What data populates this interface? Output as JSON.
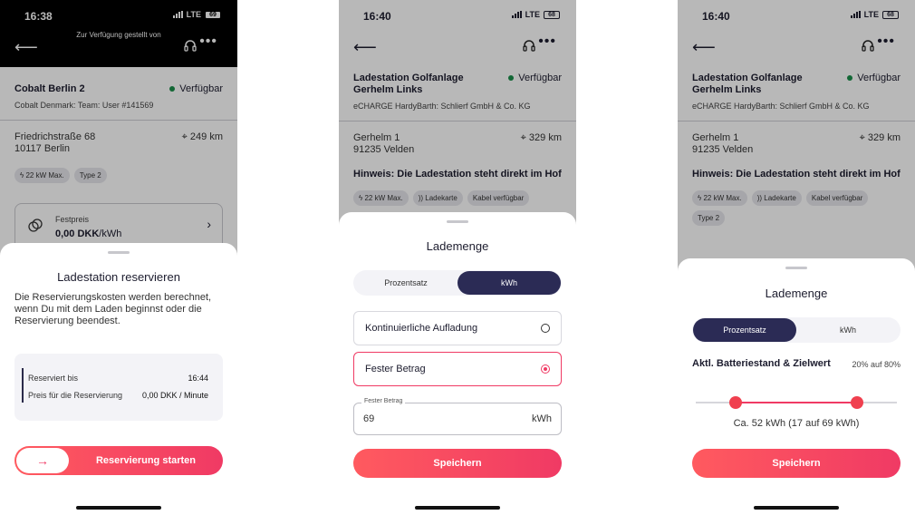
{
  "screens": [
    {
      "status": {
        "time": "16:38",
        "network": "LTE",
        "battery": "69"
      },
      "nav": {
        "subtitle": "Zur Verfügung gestellt von"
      },
      "station": {
        "name": "Cobalt Berlin 2",
        "status": "Verfügbar",
        "operator": "Cobalt Denmark: Team: User #141569",
        "street": "Friedrichstraße 68",
        "city": "10117 Berlin",
        "distance": "249 km",
        "chips": [
          "22 kW Max.",
          "Type 2"
        ],
        "price_label": "Festpreis",
        "price_value": "0,00 DKK",
        "price_unit": "/kWh"
      },
      "sheet": {
        "title": "Ladestation reservieren",
        "description": "Die Reservierungskosten werden berechnet, wenn Du mit dem Laden beginnst oder die Reservierung beendest.",
        "reserved_label": "Reserviert bis",
        "reserved_value": "16:44",
        "price_label": "Preis für die Reservierung",
        "price_value": "0,00 DKK / Minute",
        "button": "Reservierung starten"
      }
    },
    {
      "status": {
        "time": "16:40",
        "network": "LTE",
        "battery": "68"
      },
      "station": {
        "name": "Ladestation Golfanlage Gerhelm Links",
        "status": "Verfügbar",
        "operator": "eCHARGE HardyBarth: Schlierf GmbH & Co. KG",
        "street": "Gerhelm 1",
        "city": "91235 Velden",
        "distance": "329 km",
        "note": "Hinweis: Die Ladestation steht direkt im Hof",
        "chips": [
          "22 kW Max.",
          "Ladekarte",
          "Kabel verfügbar"
        ]
      },
      "sheet": {
        "title": "Lademenge",
        "tabs": [
          "Prozentsatz",
          "kWh"
        ],
        "active_tab": "kWh",
        "options": [
          "Kontinuierliche Aufladung",
          "Fester Betrag"
        ],
        "selected_option": "Fester Betrag",
        "field_label": "Fester Betrag",
        "field_value": "69",
        "field_unit": "kWh",
        "button": "Speichern"
      }
    },
    {
      "status": {
        "time": "16:40",
        "network": "LTE",
        "battery": "68"
      },
      "station": {
        "name": "Ladestation Golfanlage Gerhelm Links",
        "status": "Verfügbar",
        "operator": "eCHARGE HardyBarth: Schlierf GmbH & Co. KG",
        "street": "Gerhelm 1",
        "city": "91235 Velden",
        "distance": "329 km",
        "note": "Hinweis: Die Ladestation steht direkt im Hof",
        "chips": [
          "22 kW Max.",
          "Ladekarte",
          "Kabel verfügbar",
          "Type 2"
        ]
      },
      "sheet": {
        "title": "Lademenge",
        "tabs": [
          "Prozentsatz",
          "kWh"
        ],
        "active_tab": "Prozentsatz",
        "row_label": "Aktl. Batteriestand & Zielwert",
        "row_value": "20% auf 80%",
        "range_start_fraction": 0.2,
        "range_end_fraction": 0.8,
        "caption": "Ca. 52 kWh (17 auf 69 kWh)",
        "button": "Speichern"
      }
    }
  ],
  "colors": {
    "accent": "#f03a64",
    "segment_active": "#2b2b55",
    "available": "#1a8f4a"
  }
}
